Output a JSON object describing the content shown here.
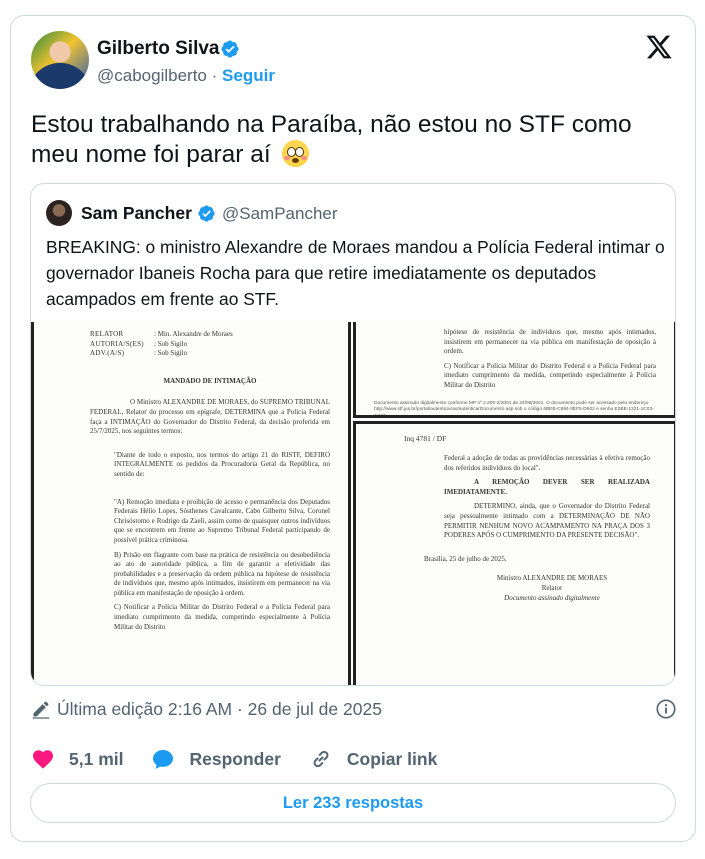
{
  "author": {
    "name": "Gilberto Silva",
    "handle": "@cabogilberto",
    "separator": "·",
    "follow_label": "Seguir"
  },
  "tweet_text": "Estou trabalhando na Paraíba, não estou no STF como meu nome foi parar aí",
  "emoji": "flushed-face",
  "quoted": {
    "name": "Sam Pancher",
    "handle": "@SamPancher",
    "text": "BREAKING: o ministro Alexandre de Moraes mandou a Polícia Federal intimar o governador Ibaneis Rocha para que retire imediatamente os deputados acampados em frente ao STF."
  },
  "document": {
    "left": {
      "relator_label": "Relator",
      "relator_value": ": Min. Alexandre de Moraes",
      "autoria_label": "Autoria/s(es)",
      "autoria_value": ": Sob Sigilo",
      "adv_label": "Adv.(a/s)",
      "adv_value": ": Sob Sigilo",
      "heading": "MANDADO DE INTIMAÇÃO",
      "para1": "O Ministro ALEXANDRE DE MORAES, do SUPREMO TRIBUNAL FEDERAL, Relator do processo em epígrafe, DETERMINA que a Polícia Federal faça a INTIMAÇÃO do Governador do Distrito Federal, da decisão proferida em 25/7/2025, nos seguintes termos:",
      "para2": "\"Diante de todo o exposto, nos termos do artigo 21 do RISTF, DEFIRO INTEGRALMENTE os pedidos da Procuradoria Geral da República, no sentido de:",
      "para3": "\"A) Remoção imediata e proibição de acesso e permanência dos Deputados Federais Hélio Lopes, Sósthenes Cavalcante, Cabo Gilberto Silva, Coronel Chrisóstomo e Rodrigo da Zaeli, assim como de quaisquer outros indivíduos que se encontrem em frente ao Supremo Tribunal Federal participando de possível prática criminosa.",
      "para4": "B) Prisão em flagrante com base na prática de resistência ou desobediência ao ato de autoridade pública, a fim de garantir a efetividade das probabilidades e a preservação da ordem pública na hipótese de resistência de indivíduos que, mesmo após intimados, insistirem em permanecer na via pública em manifestação de oposição à ordem.",
      "para5": "C) Notificar a Polícia Militar do Distrito Federal e a Polícia Federal para imediato cumprimento da medida, competindo especialmente à Polícia Militar do Distrito"
    },
    "top_right": {
      "para1": "hipótese de resistência de indivíduos que, mesmo após intimados, insistirem em permanecer na via pública em manifestação de oposição à ordem.",
      "para2": "C) Notificar a Polícia Militar do Distrito Federal e a Polícia Federal para imediato cumprimento da medida, competindo especialmente à Polícia Militar do Distrito",
      "footer": "Documento assinado digitalmente conforme MP nº 2.200-2/2001 de 24/08/2001. O documento pode ser acessado pelo endereço http://www.stf.jus.br/portal/autenticacao/autenticarDocumento.asp sob o código 6BEB-C894-3EF5-D502 e senha E2BE-1321-1C03-A3A9"
    },
    "bottom_right": {
      "ref": "Inq 4781 / DF",
      "para1": "Federal a adoção de todas as providências necessárias à efetiva remoção dos referidos indivíduos do local\".",
      "para2": "A REMOÇÃO DEVER SER REALIZADA IMEDIATAMENTE.",
      "para3": "DETERMINO, ainda, que o Governador do Distrito Federal seja pessoalmente intimado com a DETERMINAÇÃO DE NÃO PERMITIR NENHUM NOVO ACAMPAMENTO NA PRAÇA DOS 3 PODERES APÓS O CUMPRIMENTO DA PRESENTE DECISÃO\".",
      "date": "Brasília, 25 de julho de 2025.",
      "signer": "Ministro ALEXANDRE DE MORAES",
      "role": "Relator",
      "signed": "Documento assinado digitalmente"
    }
  },
  "edited": {
    "text": "Última edição 2:16 AM · 26 de jul de 2025"
  },
  "actions": {
    "likes": "5,1 mil",
    "reply_label": "Responder",
    "copy_label": "Copiar link"
  },
  "replies_button": "Ler 233 respostas",
  "colors": {
    "accent": "#1d9bf0",
    "like": "#f91880",
    "text": "#0f1419",
    "muted": "#536471",
    "border": "#cfd9de"
  }
}
